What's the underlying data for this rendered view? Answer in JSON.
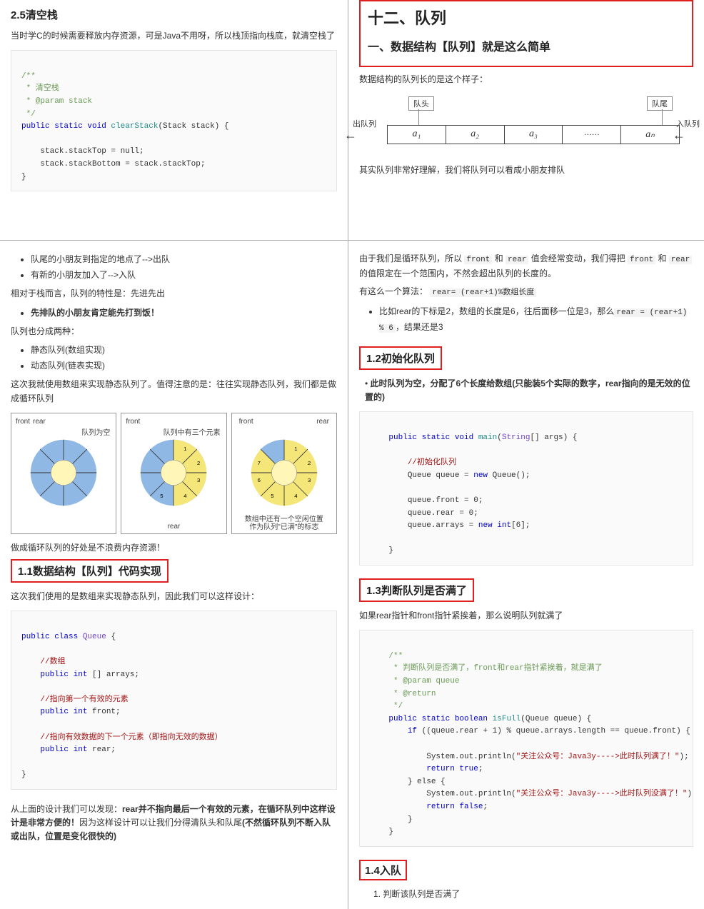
{
  "tl": {
    "h": "2.5清空栈",
    "p1": "当时学C的时候需要释放内存资源，可是Java不用呀，所以栈顶指向栈底，就清空栈了",
    "code": {
      "c1": "/**",
      "c2": " * 清空栈",
      "c3": " * @param stack",
      "c4": " */",
      "sig1": "public static void",
      "sig2": " clearStack",
      "sig3": "(Stack stack) {",
      "b1": "    stack.stackTop = null;",
      "b2": "    stack.stackBottom = stack.stackTop;",
      "close": "}"
    }
  },
  "tr": {
    "h": "十二、队列",
    "sub": "一、数据结构【队列】就是这么简单",
    "p1": "数据结构的队列长的是这个样子：",
    "diag": {
      "head": "队头",
      "tail": "队尾",
      "out": "出队列",
      "in": "入队列",
      "cells": [
        "a₁",
        "a₂",
        "a₃",
        "……",
        "aₙ"
      ]
    },
    "p2": "其实队列非常好理解，我们将队列可以看成小朋友排队"
  },
  "bl": {
    "li1": "队尾的小朋友到指定的地点了-->出队",
    "li2": "有新的小朋友加入了-->入队",
    "p1": "相对于栈而言，队列的特性是：先进先出",
    "li3": "先排队的小朋友肯定能先打到饭！",
    "p2": "队列也分成两种：",
    "li4": "静态队列(数组实现)",
    "li5": "动态队列(链表实现)",
    "p3": "这次我就使用数组来实现静态队列了。值得注意的是：往往实现静态队列，我们都是做成循环队列",
    "circ": {
      "b1_front": "front",
      "b1_rear": "rear",
      "b1_cap": "队列为空",
      "b2_front": "front",
      "b2_cap": "队列中有三个元素",
      "b3_front": "front",
      "b3_rear": "rear",
      "b3_cap1": "数组中还有一个空闲位置",
      "b3_cap2": "作为队列\"已满\"的标志",
      "b3_r": "rear"
    },
    "p4": "做成循环队列的好处是不浪费内存资源！",
    "h11": "1.1数据结构【队列】代码实现",
    "p5": "这次我们使用的是数组来实现静态队列，因此我们可以这样设计：",
    "code": {
      "l1a": "public class ",
      "l1b": "Queue",
      "l1c": " {",
      "c1": "//数组",
      "l2a": "public int",
      "l2b": " [] arrays;",
      "c2": "//指向第一个有效的元素",
      "l3a": "public int",
      "l3b": " front;",
      "c3": "//指向有效数据的下一个元素（即指向无效的数据）",
      "l4a": "public int",
      "l4b": " rear;",
      "close": "}"
    },
    "p6a": "从上面的设计我们可以发现：",
    "p6b": "rear并不指向最后一个有效的元素，在循环队列中这样设计是非常方便的！",
    "p6c": "因为这样设计可以让我们分得清队头和队尾",
    "p6d": "(不然循环队列不断入队或出队，位置是变化很快的)"
  },
  "br": {
    "p1a": "由于我们是循环队列，所以 ",
    "p1b": "front",
    "p1c": " 和 ",
    "p1d": "rear",
    "p1e": " 值会经常变动，我们得把 ",
    "p1f": "front",
    "p1g": " 和 ",
    "p1h": "rear",
    "p1i": " 的值限定在一个范围内，不然会超出队列的长度的。",
    "p2a": "有这么一个算法： ",
    "p2b": "rear= (rear+1)%数组长度",
    "li1a": "比如rear的下标是2，数组的长度是6，往后面移一位是3，那么",
    "li1b": "rear = (rear+1) % 6",
    "li1c": "，结果还是3",
    "h12": "1.2初始化队列",
    "p3a": "此时队列为空，分配了6个长度给数组(只能装5个实际的数字，rear指向的是无效的位置的)",
    "code12": {
      "l1a": "public static void ",
      "l1b": "main",
      "l1c": "(",
      "l1d": "String",
      "l1e": "[] args) {",
      "c1": "//初始化队列",
      "l2a": "Queue queue = ",
      "l2b": "new",
      "l2c": " Queue();",
      "l3": "queue.front = 0;",
      "l4": "queue.rear = 0;",
      "l5a": "queue.arrays = ",
      "l5b": "new int",
      "l5c": "[6];",
      "close": "}"
    },
    "h13": "1.3判断队列是否满了",
    "p4": "如果rear指针和front指针紧挨着，那么说明队列就满了",
    "code13": {
      "c1": "/**",
      "c2": " * 判断队列是否满了，front和rear指针紧挨着，就是满了",
      "c3": " * @param queue",
      "c4": " * @return",
      "c5": " */",
      "l1a": "public static boolean ",
      "l1b": "isFull",
      "l1c": "(Queue queue) {",
      "l2a": "if ",
      "l2b": "((queue.rear + 1) % queue.arrays.length == queue.front) {",
      "l3a": "System.out.println(",
      "l3b": "\"关注公众号：Java3y---->此时队列满了！\"",
      "l3c": ");",
      "l4a": "return true",
      "l5": "} else {",
      "l6a": "System.out.println(",
      "l6b": "\"关注公众号：Java3y---->此时队列没满了！\"",
      "l6c": ");",
      "l7a": "return false",
      "l8": "}",
      "close": "}"
    },
    "h14": "1.4入队",
    "oli1": "1. 判断该队列是否满了"
  }
}
